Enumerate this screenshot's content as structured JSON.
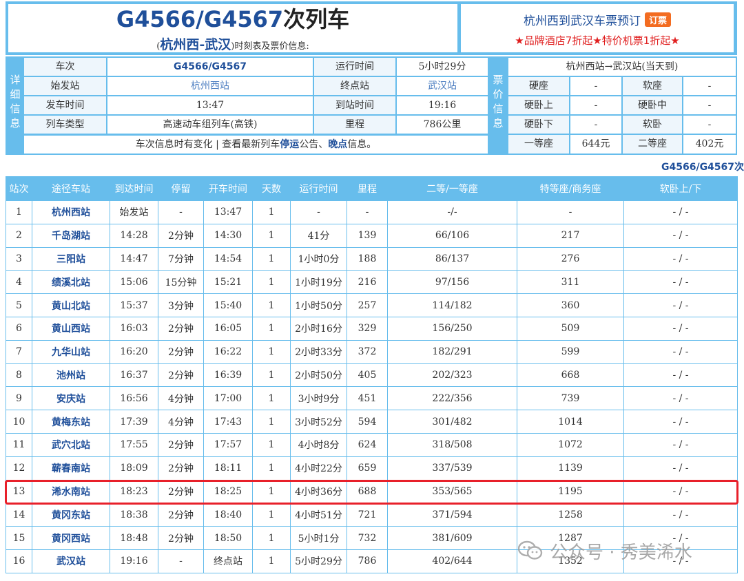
{
  "header": {
    "train_code": "G4566/G4567",
    "title_suffix": "次列车",
    "route_paren_open": "(",
    "route": "杭州西-武汉",
    "route_paren_close": ")",
    "subtitle_suffix": "时刻表及票价信息:",
    "booking_text": "杭州西到武汉车票预订",
    "booking_button": "订票",
    "promo": "★品牌酒店7折起★特价机票1折起★"
  },
  "details": {
    "side_label": "详细信息",
    "rows": [
      {
        "l1": "车次",
        "v1": "G4566/G4567",
        "l2": "运行时间",
        "v2": "5小时29分"
      },
      {
        "l1": "始发站",
        "v1": "杭州西站",
        "l2": "终点站",
        "v2": "武汉站"
      },
      {
        "l1": "发车时间",
        "v1": "13:47",
        "l2": "到站时间",
        "v2": "19:16"
      },
      {
        "l1": "列车类型",
        "v1": "高速动车组列车(高铁)",
        "l2": "里程",
        "v2": "786公里"
      }
    ],
    "note_pre": "车次信息时有变化 | 查看最新列车",
    "note_link1": "停运",
    "note_mid": "公告、",
    "note_link2": "晚点",
    "note_post": "信息。"
  },
  "prices": {
    "side_label": "票价信息",
    "route_line": "杭州西站→武汉站(当天到)",
    "rows": [
      {
        "a": "硬座",
        "av": "-",
        "b": "软座",
        "bv": "-"
      },
      {
        "a": "硬卧上",
        "av": "-",
        "b": "硬卧中",
        "bv": "-"
      },
      {
        "a": "硬卧下",
        "av": "-",
        "b": "软卧",
        "bv": "-"
      },
      {
        "a": "一等座",
        "av": "644元",
        "b": "二等座",
        "bv": "402元"
      }
    ]
  },
  "timetable_code": "G4566/G4567次",
  "timetable": {
    "headers": [
      "站次",
      "途径车站",
      "到达时间",
      "停留",
      "开车时间",
      "天数",
      "运行时间",
      "里程",
      "二等/一等座",
      "特等座/商务座",
      "软卧上/下"
    ],
    "rows": [
      [
        "1",
        "杭州西站",
        "始发站",
        "-",
        "13:47",
        "1",
        "-",
        "-",
        "-/-",
        "-",
        "- / -"
      ],
      [
        "2",
        "千岛湖站",
        "14:28",
        "2分钟",
        "14:30",
        "1",
        "41分",
        "139",
        "66/106",
        "217",
        "- / -"
      ],
      [
        "3",
        "三阳站",
        "14:47",
        "7分钟",
        "14:54",
        "1",
        "1小时0分",
        "188",
        "86/137",
        "276",
        "- / -"
      ],
      [
        "4",
        "绩溪北站",
        "15:06",
        "15分钟",
        "15:21",
        "1",
        "1小时19分",
        "216",
        "97/156",
        "311",
        "- / -"
      ],
      [
        "5",
        "黄山北站",
        "15:37",
        "3分钟",
        "15:40",
        "1",
        "1小时50分",
        "257",
        "114/182",
        "360",
        "- / -"
      ],
      [
        "6",
        "黄山西站",
        "16:03",
        "2分钟",
        "16:05",
        "1",
        "2小时16分",
        "329",
        "156/250",
        "509",
        "- / -"
      ],
      [
        "7",
        "九华山站",
        "16:20",
        "2分钟",
        "16:22",
        "1",
        "2小时33分",
        "372",
        "182/291",
        "599",
        "- / -"
      ],
      [
        "8",
        "池州站",
        "16:37",
        "2分钟",
        "16:39",
        "1",
        "2小时50分",
        "405",
        "202/323",
        "668",
        "- / -"
      ],
      [
        "9",
        "安庆站",
        "16:56",
        "4分钟",
        "17:00",
        "1",
        "3小时9分",
        "451",
        "222/356",
        "739",
        "- / -"
      ],
      [
        "10",
        "黄梅东站",
        "17:39",
        "4分钟",
        "17:43",
        "1",
        "3小时52分",
        "594",
        "301/482",
        "1014",
        "- / -"
      ],
      [
        "11",
        "武穴北站",
        "17:55",
        "2分钟",
        "17:57",
        "1",
        "4小时8分",
        "624",
        "318/508",
        "1072",
        "- / -"
      ],
      [
        "12",
        "蕲春南站",
        "18:09",
        "2分钟",
        "18:11",
        "1",
        "4小时22分",
        "659",
        "337/539",
        "1139",
        "- / -"
      ],
      [
        "13",
        "浠水南站",
        "18:23",
        "2分钟",
        "18:25",
        "1",
        "4小时36分",
        "688",
        "353/565",
        "1195",
        "- / -"
      ],
      [
        "14",
        "黄冈东站",
        "18:38",
        "2分钟",
        "18:40",
        "1",
        "4小时51分",
        "721",
        "371/594",
        "1258",
        "- / -"
      ],
      [
        "15",
        "黄冈西站",
        "18:48",
        "2分钟",
        "18:50",
        "1",
        "5小时1分",
        "732",
        "381/609",
        "1287",
        "- / -"
      ],
      [
        "16",
        "武汉站",
        "19:16",
        "-",
        "终点站",
        "1",
        "5小时29分",
        "786",
        "402/644",
        "1352",
        "- / -"
      ]
    ]
  },
  "watermark": "公众号 · 秀美浠水",
  "colors": {
    "frame": "#67bdec",
    "highlight": "#e8202a",
    "station_text": "#1f4f9a",
    "promo": "#e01e1e",
    "button": "#f36c21"
  }
}
